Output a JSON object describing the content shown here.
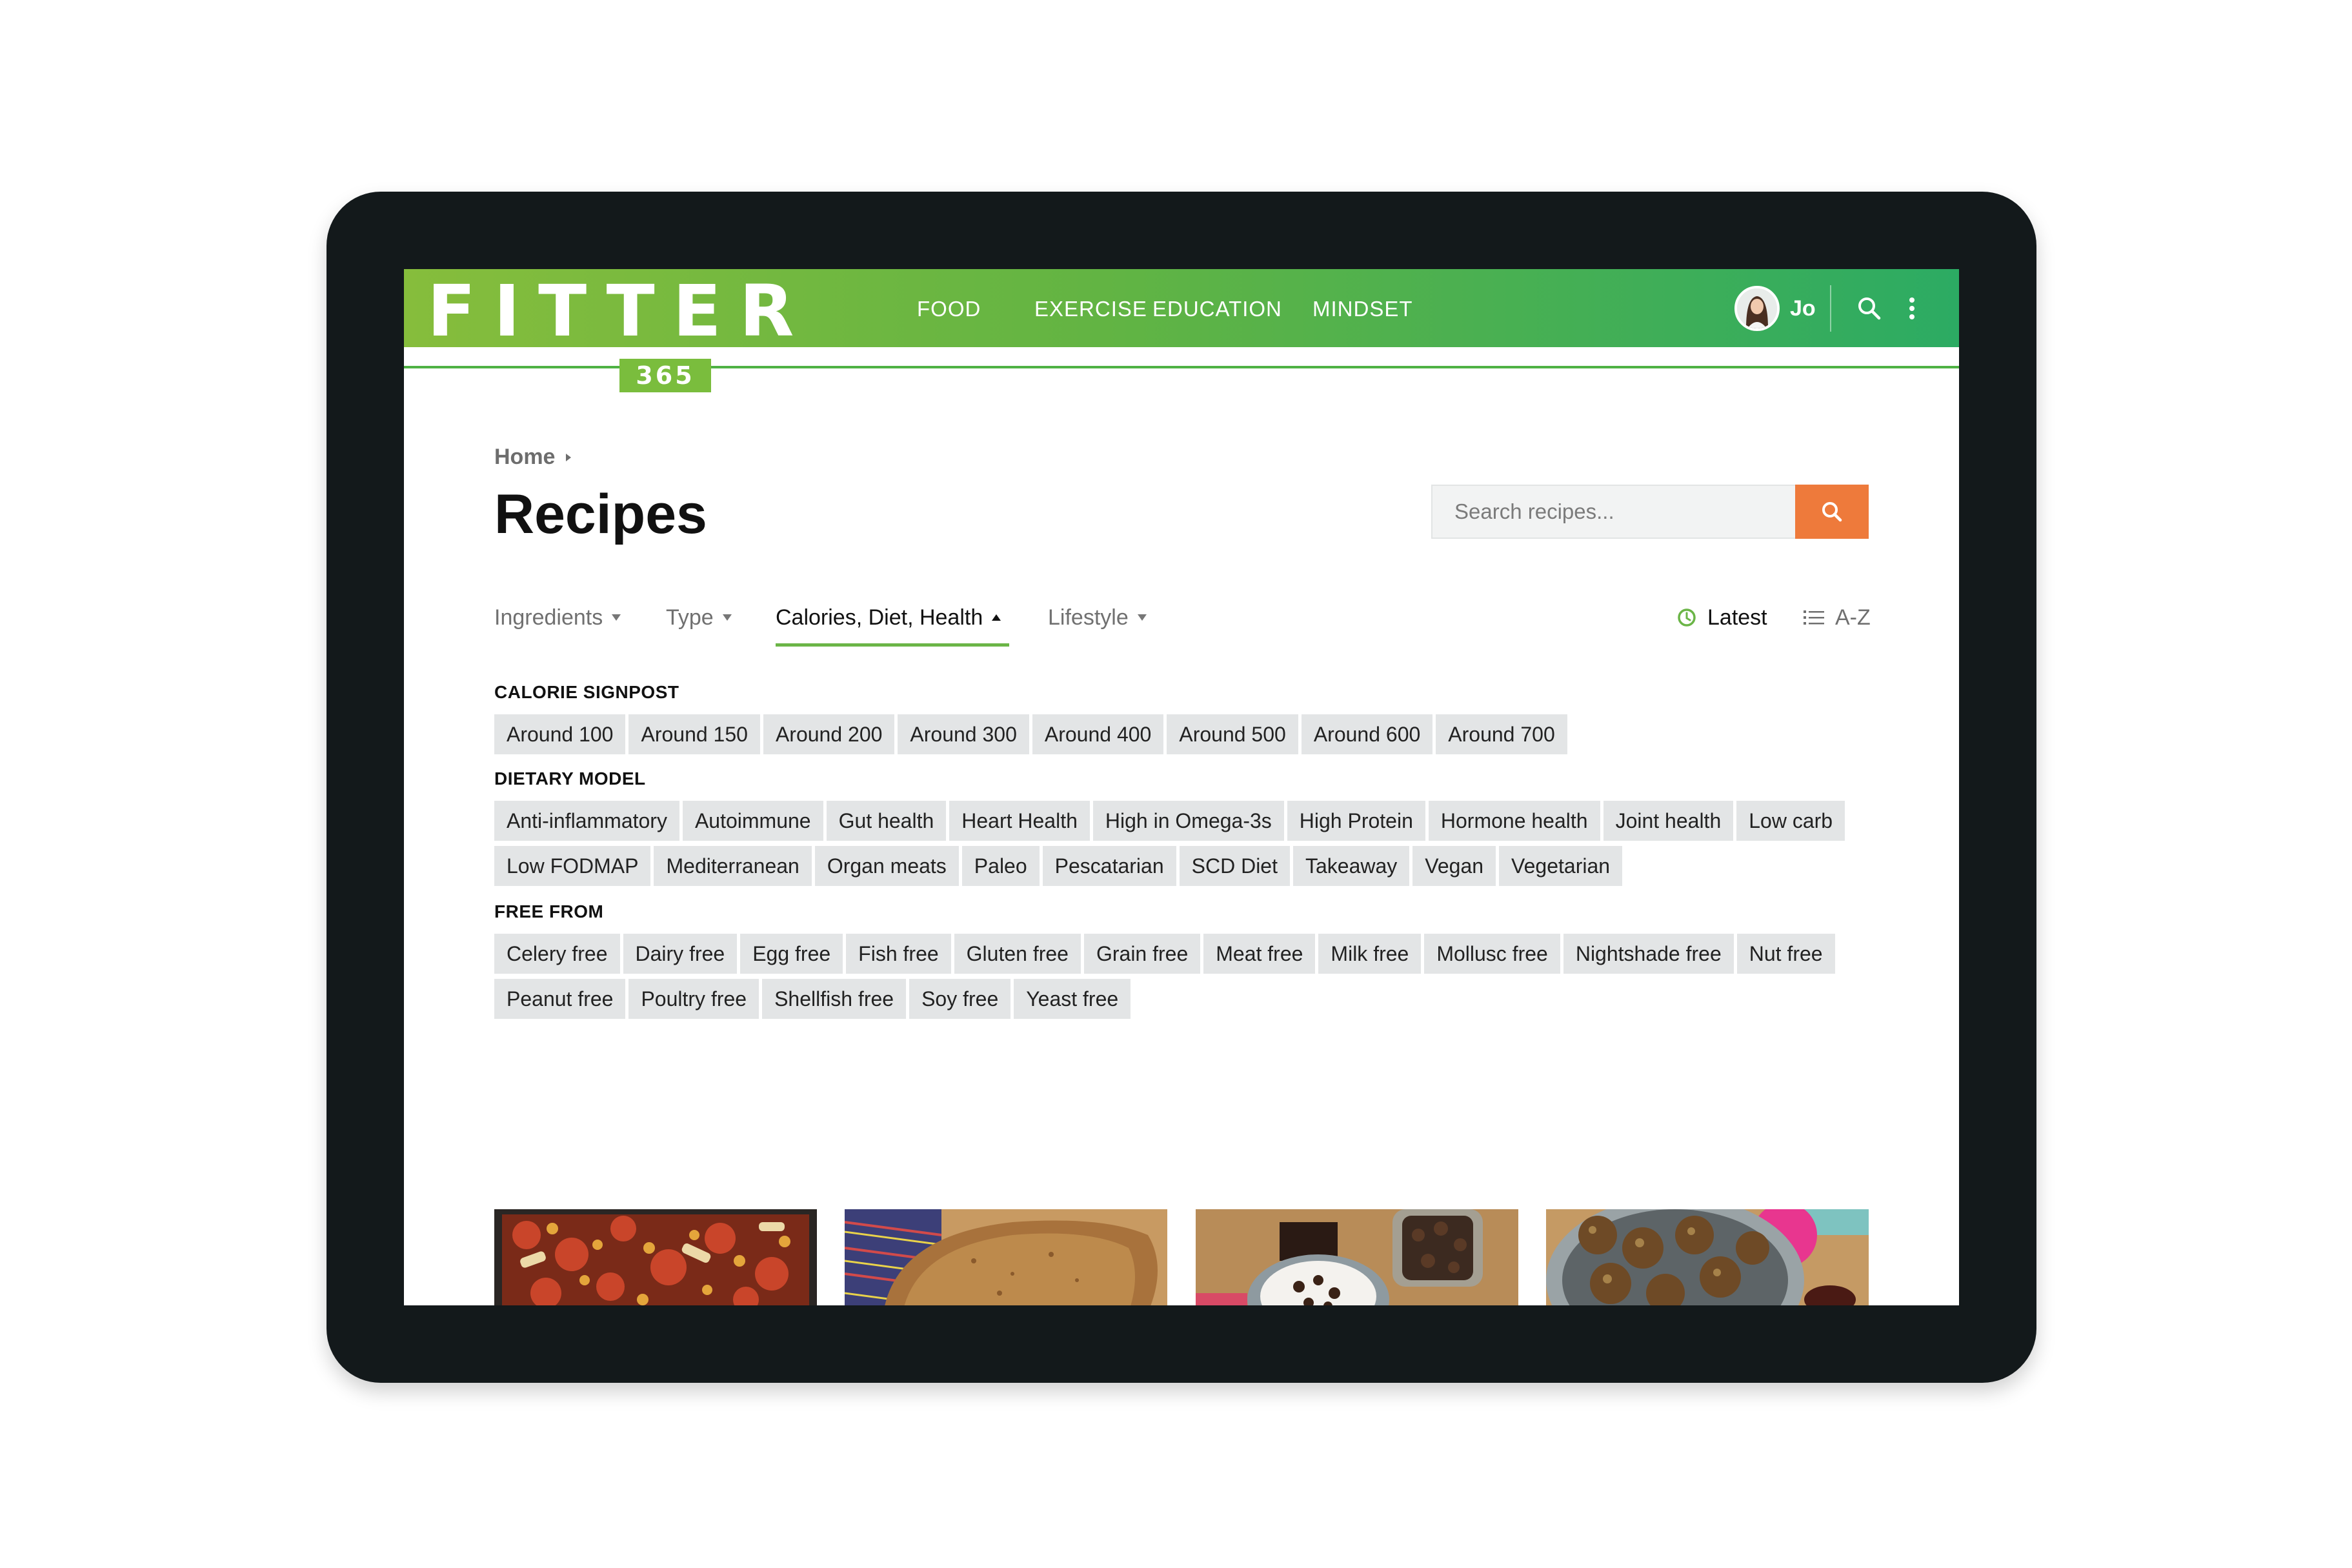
{
  "header": {
    "logo_word": "FITTER",
    "logo_badge": "365",
    "nav": [
      "FOOD",
      "EXERCISE",
      "EDUCATION",
      "MINDSET"
    ],
    "user_name": "Jo"
  },
  "breadcrumb": {
    "home": "Home"
  },
  "page_title": "Recipes",
  "search": {
    "placeholder": "Search recipes..."
  },
  "filters": {
    "tabs": [
      {
        "label": "Ingredients",
        "active": false
      },
      {
        "label": "Type",
        "active": false
      },
      {
        "label": "Calories, Diet, Health",
        "active": true
      },
      {
        "label": "Lifestyle",
        "active": false
      }
    ],
    "sort_latest": "Latest",
    "sort_az": "A-Z"
  },
  "groups": {
    "calorie": {
      "title": "CALORIE SIGNPOST",
      "tags": [
        "Around 100",
        "Around 150",
        "Around 200",
        "Around 300",
        "Around 400",
        "Around 500",
        "Around 600",
        "Around 700"
      ]
    },
    "dietary": {
      "title": "DIETARY MODEL",
      "row1": [
        "Anti-inflammatory",
        "Autoimmune",
        "Gut health",
        "Heart Health",
        "High in Omega-3s",
        "High Protein",
        "Hormone health",
        "Joint health",
        "Low carb"
      ],
      "row2": [
        "Low FODMAP",
        "Mediterranean",
        "Organ meats",
        "Paleo",
        "Pescatarian",
        "SCD Diet",
        "Takeaway",
        "Vegan",
        "Vegetarian"
      ]
    },
    "free_from": {
      "title": "FREE FROM",
      "row1": [
        "Celery free",
        "Dairy free",
        "Egg free",
        "Fish free",
        "Gluten free",
        "Grain free",
        "Meat free",
        "Milk free",
        "Mollusc free",
        "Nightshade free",
        "Nut free"
      ],
      "row2": [
        "Peanut free",
        "Poultry free",
        "Shellfish free",
        "Soy free",
        "Yeast free"
      ]
    }
  },
  "colors": {
    "header_start": "#86bd3c",
    "header_end": "#2cab63",
    "accent_green": "#6bb547",
    "search_button": "#ee7a3b",
    "tag_bg": "#e3e5e6",
    "frame": "#13191b"
  },
  "icons": {
    "search": "search-icon",
    "more": "more-vertical-icon",
    "clock": "clock-icon",
    "list": "list-icon"
  }
}
